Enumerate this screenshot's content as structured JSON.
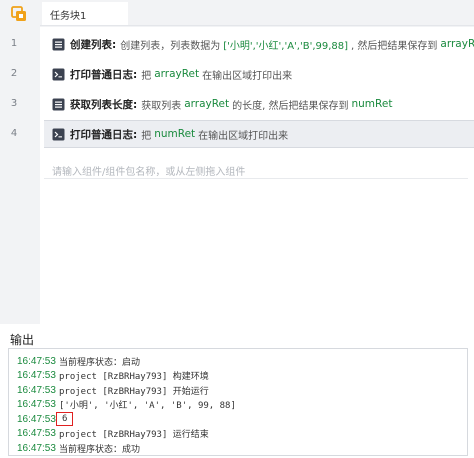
{
  "tab": {
    "label": "任务块1"
  },
  "rows": [
    {
      "num": "1",
      "parts": [
        {
          "t": "bold",
          "v": "创建列表:"
        },
        {
          "t": "txt",
          "v": "创建列表，列表数据为"
        },
        {
          "t": "val",
          "v": "['小明','小红','A','B',99,88]"
        },
        {
          "t": "txt",
          "v": ", 然后把结果保存到"
        },
        {
          "t": "var",
          "v": "arrayRet"
        }
      ]
    },
    {
      "num": "2",
      "parts": [
        {
          "t": "bold",
          "v": "打印普通日志:"
        },
        {
          "t": "txt",
          "v": "把"
        },
        {
          "t": "var",
          "v": "arrayRet"
        },
        {
          "t": "txt",
          "v": "在输出区域打印出来"
        }
      ]
    },
    {
      "num": "3",
      "parts": [
        {
          "t": "bold",
          "v": "获取列表长度:"
        },
        {
          "t": "txt",
          "v": "获取列表"
        },
        {
          "t": "var",
          "v": "arrayRet"
        },
        {
          "t": "txt",
          "v": "的长度, 然后把结果保存到"
        },
        {
          "t": "var",
          "v": "numRet"
        }
      ]
    },
    {
      "num": "4",
      "parts": [
        {
          "t": "bold",
          "v": "打印普通日志:"
        },
        {
          "t": "txt",
          "v": "把"
        },
        {
          "t": "var",
          "v": "numRet"
        },
        {
          "t": "txt",
          "v": "在输出区域打印出来"
        }
      ]
    }
  ],
  "editor": {
    "placeholder": "请输入组件/组件包名称，或从左侧拖入组件"
  },
  "output": {
    "title": "输出",
    "lines": [
      {
        "time": "16:47:53",
        "msg": "当前程序状态：启动"
      },
      {
        "time": "16:47:53",
        "msg": "project [RzBRHay793] 构建环境"
      },
      {
        "time": "16:47:53",
        "msg": "project [RzBRHay793] 开始运行"
      },
      {
        "time": "16:47:53",
        "msg": "['小明', '小红', 'A', 'B', 99, 88]"
      },
      {
        "time": "16:47:53",
        "msg": "6",
        "highlight": true
      },
      {
        "time": "16:47:53",
        "msg": "project [RzBRHay793] 运行结束"
      },
      {
        "time": "16:47:53",
        "msg": "当前程序状态：成功"
      }
    ]
  },
  "colors": {
    "accent": "#1a8a3e",
    "highlight": "#e02020",
    "app_icon": "#f0a21a"
  }
}
